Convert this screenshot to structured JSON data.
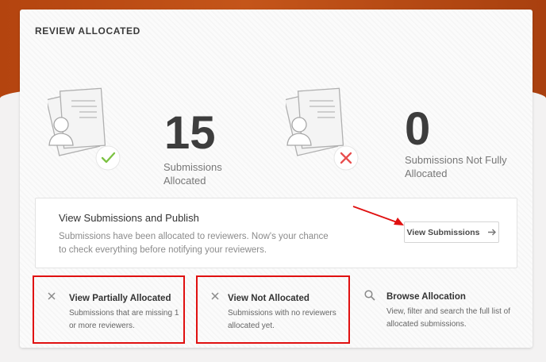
{
  "section_title": "REVIEW ALLOCATED",
  "stats": [
    {
      "value": "15",
      "label": "Submissions Allocated",
      "status": "check"
    },
    {
      "value": "0",
      "label": "Submissions Not Fully Allocated",
      "status": "cross"
    }
  ],
  "publish": {
    "heading": "View Submissions and Publish",
    "description": "Submissions have been allocated to reviewers. Now's your chance to check everything before notifying your reviewers.",
    "button_label": "View Submissions"
  },
  "options": [
    {
      "title": "View Partially Allocated",
      "description": "Submissions that are missing 1 or more reviewers.",
      "icon": "close-icon"
    },
    {
      "title": "View Not Allocated",
      "description": "Submissions with no reviewers allocated yet.",
      "icon": "close-icon"
    },
    {
      "title": "Browse Allocation",
      "description": "View, filter and search the full list of allocated submissions.",
      "icon": "search-icon"
    }
  ],
  "colors": {
    "accent_orange": "#c4551a",
    "success_green": "#7cc242",
    "error_red": "#e84e4e",
    "annotation_red": "#e01010"
  }
}
